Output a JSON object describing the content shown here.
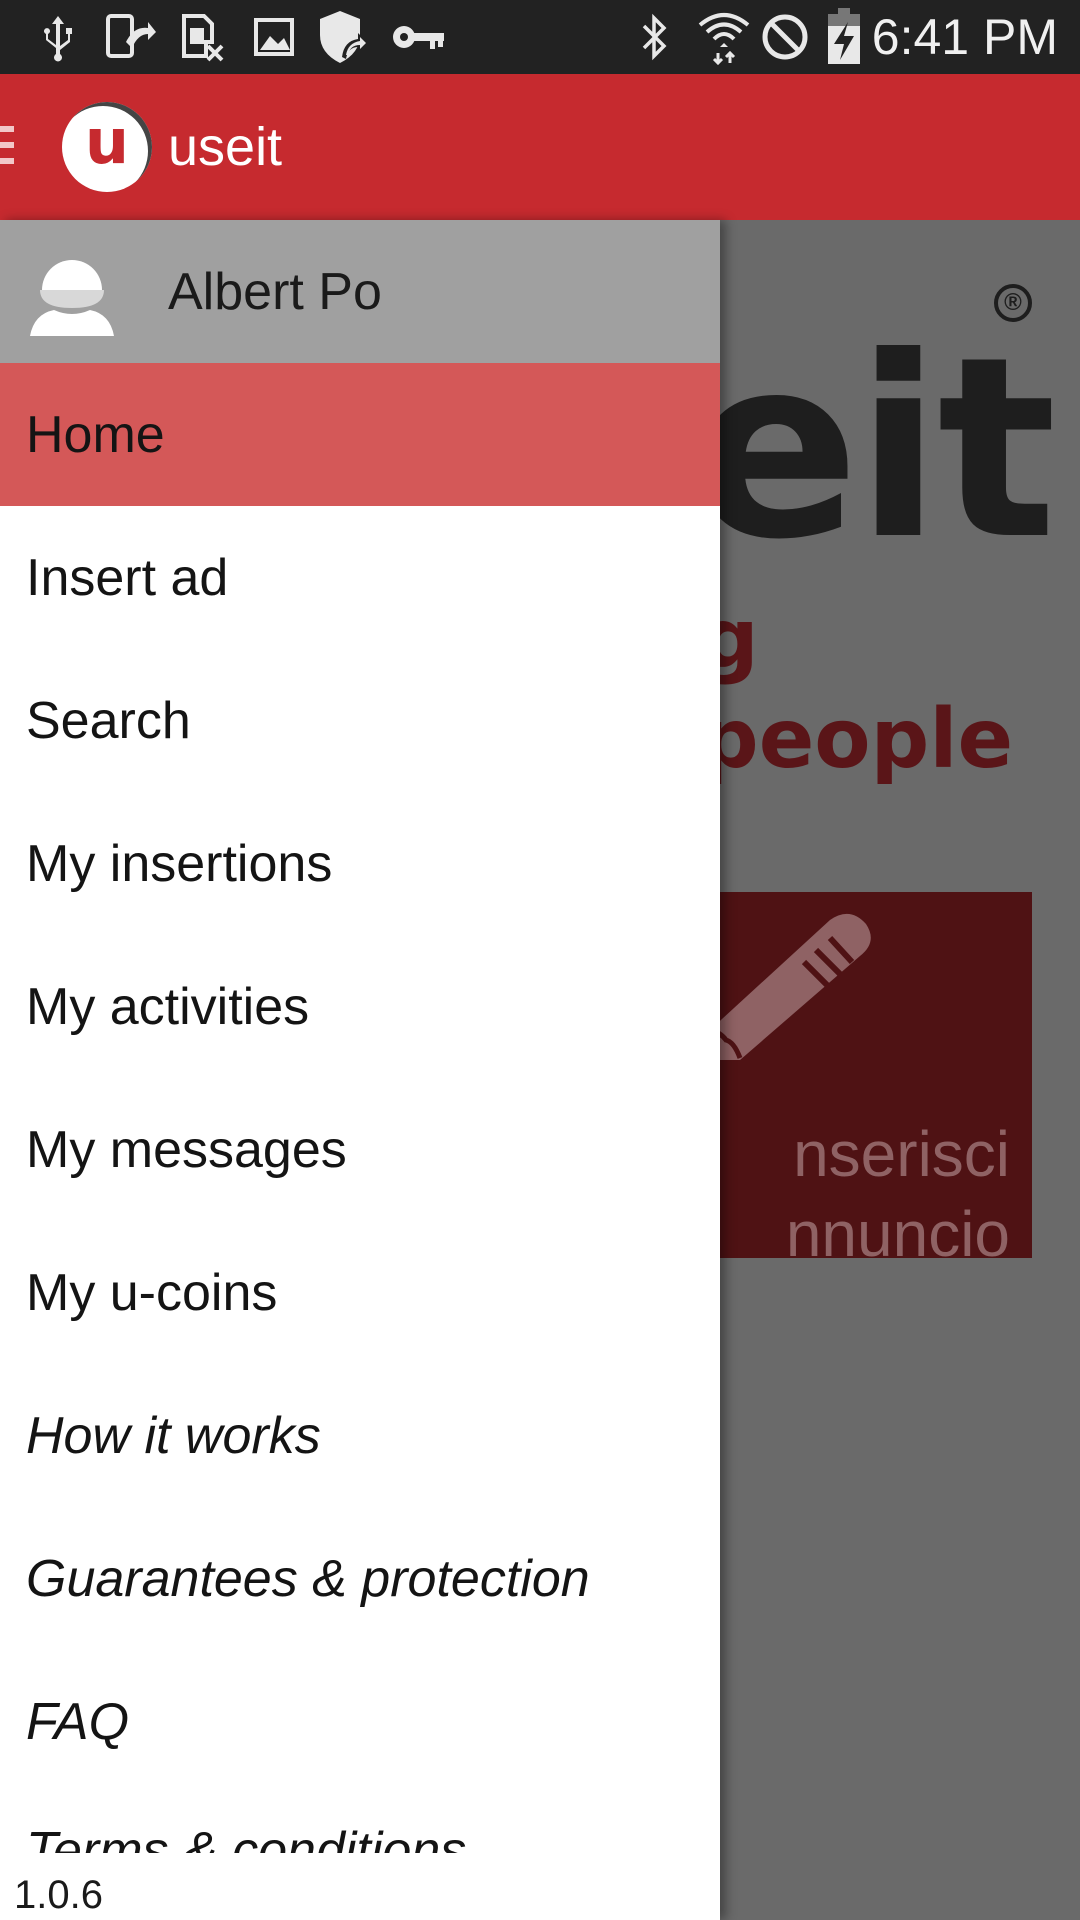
{
  "status_bar": {
    "icons": [
      "usb-icon",
      "phone-transfer-icon",
      "sim-blocked-icon",
      "image-icon",
      "shield-icon",
      "key-icon",
      "bluetooth-icon",
      "wifi-icon",
      "do-not-disturb-icon",
      "battery-charging-icon"
    ],
    "time": "6:41 PM"
  },
  "app_bar": {
    "logo_letter": "u",
    "title": "useit",
    "color": "#c62a2f"
  },
  "background": {
    "registered_mark": "®",
    "logo_text": "eit",
    "tagline": "g people",
    "card_line1": "nserisci",
    "card_line2": "nnuncio"
  },
  "drawer": {
    "user_name": "Albert Po",
    "items": [
      {
        "label": "Home",
        "active": true
      },
      {
        "label": "Insert ad"
      },
      {
        "label": "Search"
      },
      {
        "label": "My insertions"
      },
      {
        "label": "My activities"
      },
      {
        "label": "My messages"
      },
      {
        "label": "My u-coins"
      },
      {
        "label": "How it works",
        "italic": true
      },
      {
        "label": "Guarantees & protection",
        "italic": true
      },
      {
        "label": "FAQ",
        "italic": true
      },
      {
        "label": "Terms & conditions",
        "italic": true
      }
    ],
    "version": "1.0.6",
    "active_color": "#d45858"
  }
}
